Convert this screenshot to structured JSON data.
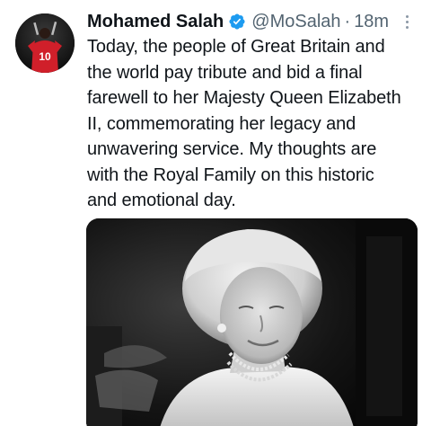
{
  "tweet": {
    "display_name": "Mohamed Salah",
    "handle": "@MoSalah",
    "separator": "·",
    "time": "18m",
    "text_lines": [
      "Today, the people of Great Britain and",
      "the world pay tribute and bid a final",
      "farewell to her Majesty Queen Elizabeth",
      "II, commemorating her legacy and",
      "unwavering service. My thoughts are",
      "with the Royal Family on this historic",
      "and emotional day."
    ],
    "avatar_jersey_number": "10",
    "verified_icon": "verified-badge-icon",
    "more_icon": "more-options-icon"
  },
  "colors": {
    "text": "#0f1419",
    "secondary": "#536471",
    "verified": "#1d9bf0",
    "background": "#ffffff"
  }
}
